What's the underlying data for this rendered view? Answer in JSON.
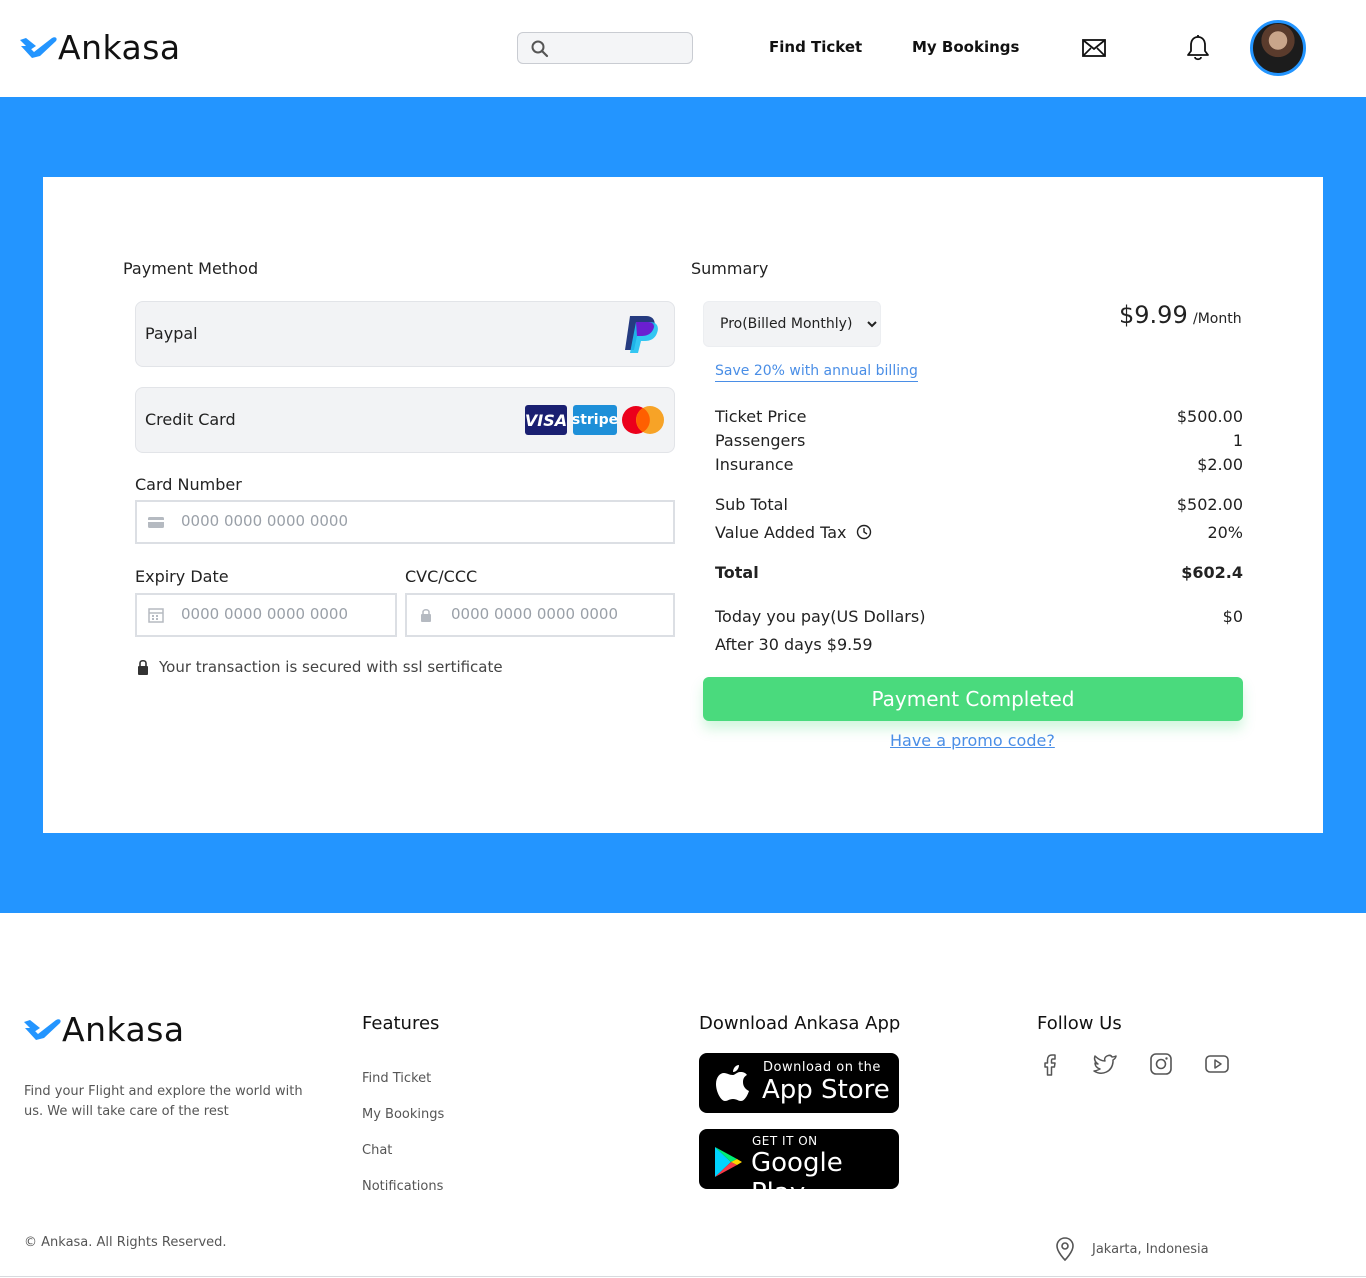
{
  "header": {
    "brand": "Ankasa",
    "search_placeholder": "",
    "nav": {
      "find_ticket": "Find Ticket",
      "my_bookings": "My Bookings"
    }
  },
  "payment": {
    "title": "Payment Method",
    "options": {
      "paypal": "Paypal",
      "credit_card": "Credit Card"
    },
    "card_brands": {
      "visa": "VISA",
      "stripe": "stripe"
    },
    "card_number_label": "Card Number",
    "card_number_placeholder": "0000 0000 0000 0000",
    "expiry_label": "Expiry Date",
    "expiry_placeholder": "0000 0000 0000 0000",
    "cvc_label": "CVC/CCC",
    "cvc_placeholder": "0000 0000 0000 0000",
    "secure_note": "Your transaction is secured with ssl sertificate"
  },
  "summary": {
    "title": "Summary",
    "plan_selected": "Pro(Billed Monthly)",
    "price": "$9.99",
    "per": "/Month",
    "save_link": "Save 20% with annual billing",
    "rows": {
      "ticket_price": {
        "label": "Ticket Price",
        "value": "$500.00"
      },
      "passengers": {
        "label": "Passengers",
        "value": "1"
      },
      "insurance": {
        "label": "Insurance",
        "value": "$2.00"
      },
      "sub_total": {
        "label": "Sub Total",
        "value": "$502.00"
      },
      "vat": {
        "label": "Value Added Tax",
        "value": "20%"
      },
      "total": {
        "label": "Total",
        "value": "$602.4"
      },
      "today_pay": {
        "label": "Today you pay(US Dollars)",
        "value": "$0"
      },
      "after": {
        "label": "After 30 days $9.59"
      }
    },
    "pay_button": "Payment Completed",
    "promo_link": "Have a promo code?"
  },
  "footer": {
    "brand": "Ankasa",
    "tagline": "Find your Flight and explore the world with us. We will take care of the rest",
    "features_title": "Features",
    "features": [
      "Find Ticket",
      "My Bookings",
      "Chat",
      "Notifications"
    ],
    "app_title": "Download Ankasa App",
    "app_store_small": "Download on the",
    "app_store_big": "App Store",
    "google_small": "GET IT ON",
    "google_big": "Google Play",
    "follow_title": "Follow Us",
    "copyright": "© Ankasa. All Rights Reserved.",
    "location": "Jakarta, Indonesia"
  },
  "colors": {
    "accent": "#2395ff",
    "success": "#4ada7d",
    "link": "#4a8ee6"
  }
}
